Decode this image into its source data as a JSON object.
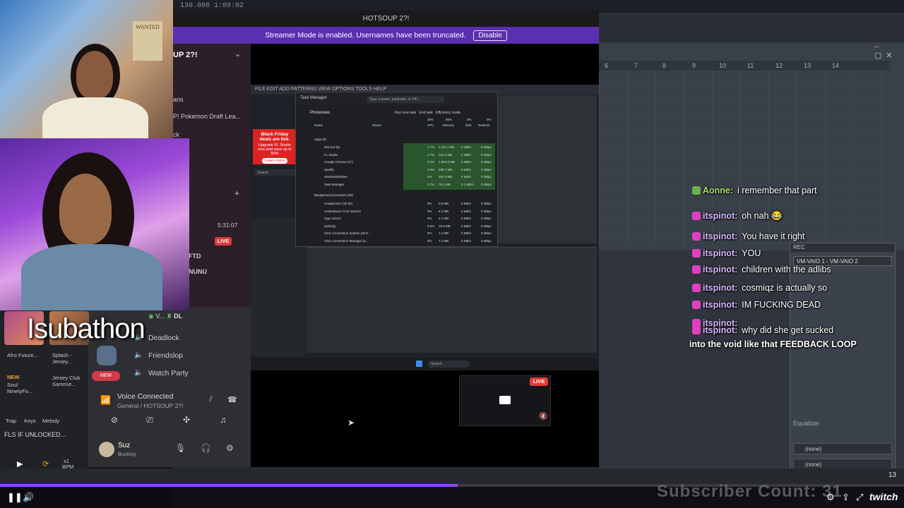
{
  "window": {
    "title": "HOTSOUP 2?!"
  },
  "streamer_mode": {
    "message": "Streamer Mode is enabled. Usernames have been truncated.",
    "disable_label": "Disable"
  },
  "discord": {
    "server_title": "UP 2?!",
    "side_labels": [
      "ans",
      "P! Pokemon Draft Lea...",
      "ck",
      "FTD",
      "NUNU"
    ],
    "timer": "5:31:07",
    "live_label": "LIVE",
    "user_tag": "V...",
    "user_tag2": "DL",
    "channels": [
      "Deadlock",
      "Friendslop",
      "Watch Party"
    ],
    "new_badge": "NEW",
    "voice": {
      "title": "Voice Connected",
      "subtitle": "General / HOTSOUP 2?!"
    },
    "user": {
      "name": "Suz",
      "status": "Busting"
    }
  },
  "screen_share": {
    "menu": "FILE EDIT ADD PATTERNS VIEW OPTIONS TOOLS HELP",
    "live_label": "LIVE",
    "ad": {
      "line1": "Black Friday deals are live.",
      "line2": "Upgrade FL Studio now and save up to 50%",
      "button": "Learn more"
    },
    "search_label": "Search",
    "task_manager": {
      "title": "Task Manager",
      "search_placeholder": "Type a name, publisher, or PID...",
      "section": "Processes",
      "run_new": "Run new task",
      "end_task": "End task",
      "efficiency": "Efficiency mode",
      "col_headers": [
        "Name",
        "Status",
        "CPU",
        "Memory",
        "Disk",
        "Network"
      ],
      "totals": [
        "36%",
        "86%",
        "3%",
        "0%"
      ],
      "apps_header": "Apps (6)",
      "apps": [
        {
          "name": "Discord (6)",
          "cpu": "1.7%",
          "mem": "1,111.3 MB",
          "disk": "0 MB/s",
          "net": "0 Mbps"
        },
        {
          "name": "FL Studio",
          "cpu": "1.7%",
          "mem": "240.2 MB",
          "disk": "0 MB/s",
          "net": "0 Mbps"
        },
        {
          "name": "Google Chrome (17)",
          "cpu": "0.5%",
          "mem": "1,604.8 MB",
          "disk": "0 MB/s",
          "net": "0 Mbps"
        },
        {
          "name": "Spotify",
          "cpu": "0.6%",
          "mem": "288.1 MB",
          "disk": "0 MB/s",
          "net": "0 Mbps"
        },
        {
          "name": "steamwebhelper",
          "cpu": "0%",
          "mem": "294.4 MB",
          "disk": "0 MB/s",
          "net": "0 Mbps"
        },
        {
          "name": "Task Manager",
          "cpu": "3.7%",
          "mem": "79.1 MB",
          "disk": "0.1 MB/s",
          "net": "0 Mbps"
        }
      ],
      "bg_header": "Background processes (93)",
      "bg": [
        {
          "name": "AnalyticsSrv (32 bit)",
          "cpu": "0%",
          "mem": "0.5 MB",
          "disk": "0 MB/s",
          "net": "0 Mbps"
        },
        {
          "name": "Antimalware Core Service",
          "cpu": "0%",
          "mem": "6.2 MB",
          "disk": "0 MB/s",
          "net": "0 Mbps"
        },
        {
          "name": "App Actions",
          "cpu": "0%",
          "mem": "2.1 MB",
          "disk": "0 MB/s",
          "net": "0 Mbps"
        },
        {
          "name": "audiodg",
          "cpu": "0.5%",
          "mem": "16.5 MB",
          "disk": "0 MB/s",
          "net": "0 Mbps"
        },
        {
          "name": "Citrix Connection System (32 b...",
          "cpu": "0%",
          "mem": "1.2 MB",
          "disk": "0 MB/s",
          "net": "0 Mbps"
        },
        {
          "name": "Citrix Connection Manager (3...",
          "cpu": "0%",
          "mem": "7.2 MB",
          "disk": "0 MB/s",
          "net": "0 Mbps"
        }
      ]
    }
  },
  "chat": [
    {
      "user": "Aonne:",
      "text": "i remember that part",
      "color": "#a6e06a"
    },
    {
      "user": "itspinot:",
      "text": "oh nah 😂",
      "color": "#d9b6ff"
    },
    {
      "user": "itspinot:",
      "text": "You have it right",
      "color": "#d9b6ff"
    },
    {
      "user": "itspinot:",
      "text": "YOU",
      "color": "#d9b6ff"
    },
    {
      "user": "itspinot:",
      "text": "children with the adlibs",
      "color": "#d9b6ff"
    },
    {
      "user": "itspinot:",
      "text": "cosmiqz is actually so",
      "color": "#d9b6ff"
    },
    {
      "user": "itspinot:",
      "text": "IM FUCKING DEAD",
      "color": "#d9b6ff"
    },
    {
      "user": "itspinot:",
      "text": "",
      "color": "#d9b6ff"
    },
    {
      "user": "itspinot:",
      "text": "why did she get sucked",
      "color": "#d9b6ff"
    }
  ],
  "chat_wrap": "into the void like that FEEDBACK LOOP",
  "overlay": {
    "subathon": "Isubathon",
    "subscriber_count": "Subscriber Count: 31",
    "twitch": "twitch",
    "corner_number": "13"
  },
  "webcam": {
    "poster": "WANTED"
  },
  "games": [
    {
      "title": "Afro Future...",
      "tag": ""
    },
    {
      "title": "Splash - Jersey...",
      "tag": ""
    },
    {
      "title": "Soul NinetyFo...",
      "tag": "NEW"
    },
    {
      "title": "Jersey Club Samrise...",
      "tag": ""
    }
  ],
  "game_tabs": [
    "Trap",
    "Keys",
    "Melody"
  ],
  "track_label": "FLS IF UNLOCKED...",
  "tempo": {
    "x": "x1",
    "label": "BPM"
  },
  "vaio": {
    "title": "VM-VAIO 1 - VM-VAIO 2",
    "header": "REC",
    "eq": "Equalizer",
    "slot1": "(none)",
    "slot2": "(none)"
  },
  "daw_ruler": [
    "6",
    "7",
    "8",
    "9",
    "10",
    "11",
    "12",
    "13",
    "14"
  ],
  "daw_top": "130.000   1:09:02",
  "progress": 0.506
}
